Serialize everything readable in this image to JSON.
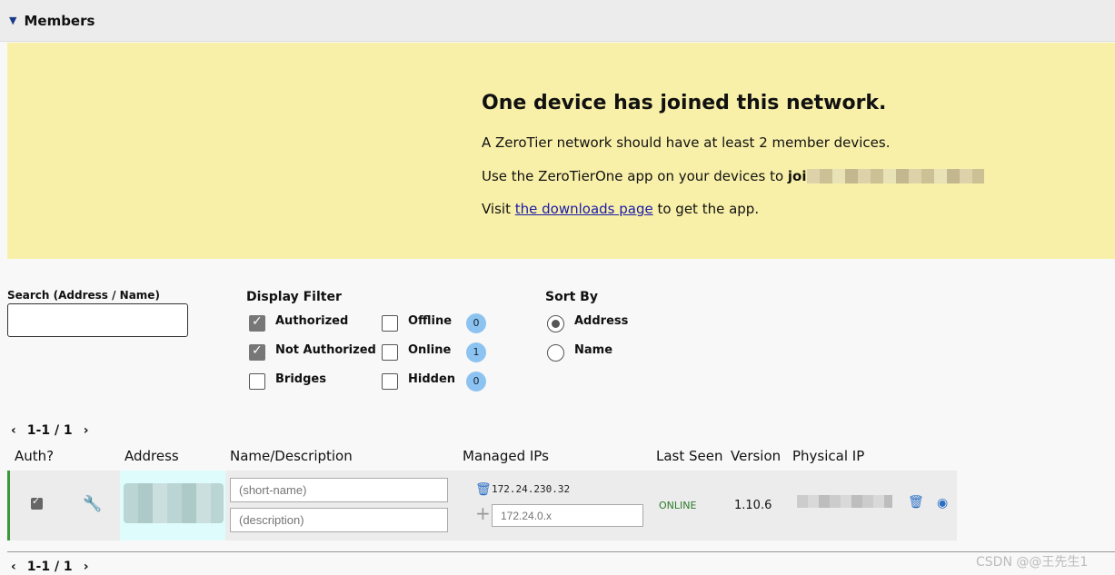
{
  "section": {
    "chevron": "chevron-down-icon",
    "title": "Members"
  },
  "notice": {
    "heading": "One device has joined this network.",
    "line1": "A ZeroTier network should have at least 2 member devices.",
    "line2_prefix": "Use the ZeroTierOne app on your devices to ",
    "line2_bold": "joi",
    "line3_prefix": "Visit ",
    "line3_link": "the downloads page",
    "line3_suffix": " to get the app."
  },
  "search": {
    "label": "Search (Address / Name)",
    "value": "",
    "placeholder": ""
  },
  "display_filter": {
    "title": "Display Filter",
    "options": [
      {
        "label": "Authorized",
        "checked": true
      },
      {
        "label": "Not Authorized",
        "checked": true
      },
      {
        "label": "Bridges",
        "checked": false
      },
      {
        "label": "Offline",
        "checked": false,
        "count": "0"
      },
      {
        "label": "Online",
        "checked": false,
        "count": "1"
      },
      {
        "label": "Hidden",
        "checked": false,
        "count": "0"
      }
    ]
  },
  "sort_by": {
    "title": "Sort By",
    "options": [
      {
        "label": "Address",
        "selected": true
      },
      {
        "label": "Name",
        "selected": false
      }
    ]
  },
  "pager": {
    "text": "1-1 / 1"
  },
  "table": {
    "headers": [
      "Auth?",
      "Address",
      "Name/Description",
      "Managed IPs",
      "Last Seen",
      "Version",
      "Physical IP"
    ],
    "rows": [
      {
        "authorized": true,
        "name_placeholder": "(short-name)",
        "desc_placeholder": "(description)",
        "managed_ip": "172.24.230.32",
        "new_ip_placeholder": "172.24.0.x",
        "last_seen": "ONLINE",
        "version": "1.10.6"
      }
    ]
  },
  "colors": {
    "notice_bg": "#f8f0a8",
    "online_green": "#2a7a2a",
    "icon_blue": "#2a6fc4",
    "badge_blue": "#8dc3f0"
  },
  "watermark": "CSDN @@王先生1"
}
